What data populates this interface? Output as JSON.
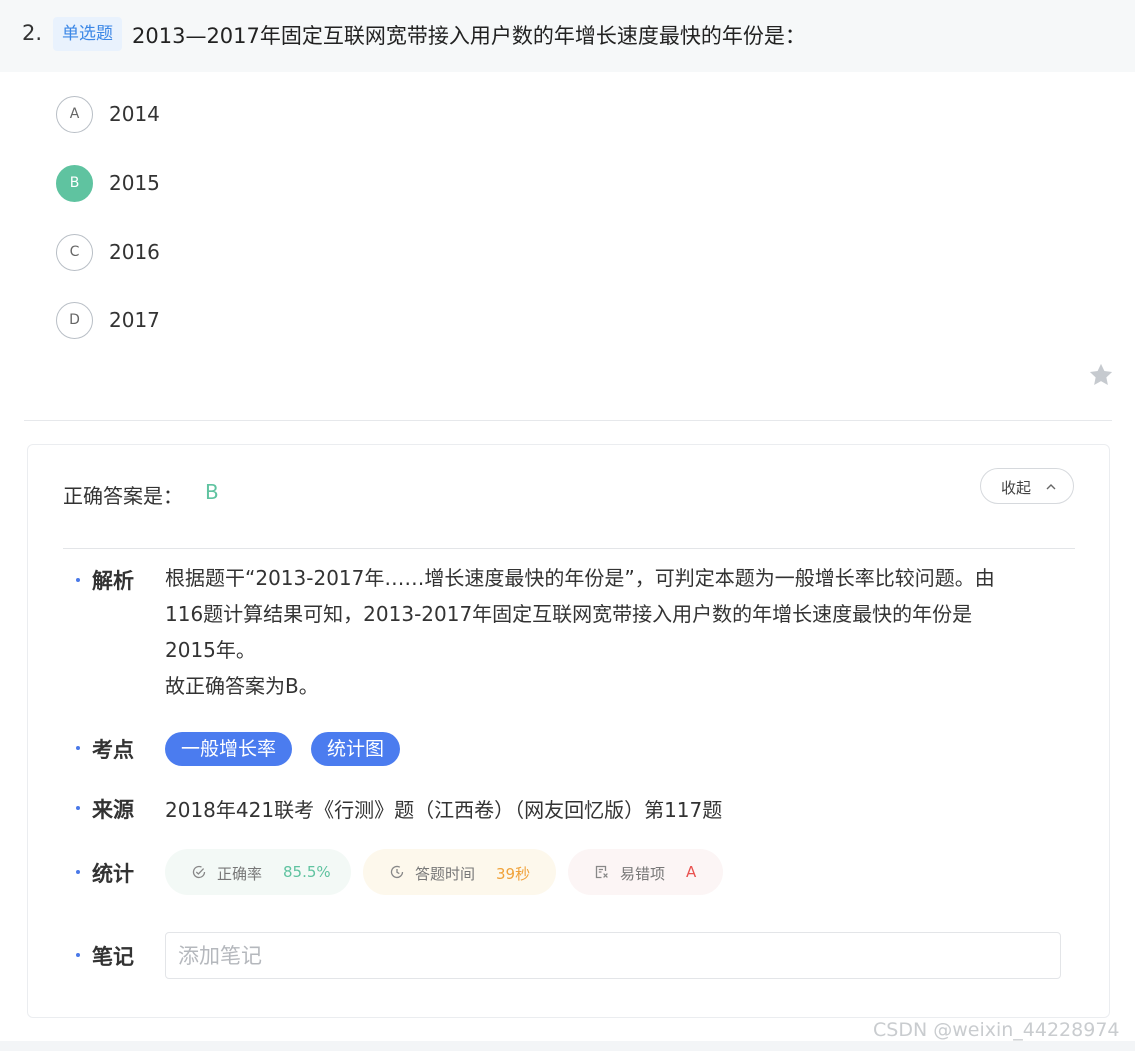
{
  "question": {
    "number": "2.",
    "type_badge": "单选题",
    "title": "2013—2017年固定互联网宽带接入用户数的年增长速度最快的年份是："
  },
  "options": [
    {
      "letter": "A",
      "text": "2014",
      "selected": false
    },
    {
      "letter": "B",
      "text": "2015",
      "selected": true
    },
    {
      "letter": "C",
      "text": "2016",
      "selected": false
    },
    {
      "letter": "D",
      "text": "2017",
      "selected": false
    }
  ],
  "favorite_icon": "star-icon",
  "answer_panel": {
    "answer_label": "正确答案是：",
    "answer_value": "B",
    "collapse_label": "收起",
    "collapse_icon": "chevron-up-icon",
    "analysis": {
      "label": "解析",
      "lines": [
        "根据题干“2013-2017年……增长速度最快的年份是”，可判定本题为一般增长率比较问题。由",
        "116题计算结果可知，2013-2017年固定互联网宽带接入用户数的年增长速度最快的年份是",
        "2015年。",
        "故正确答案为B。"
      ]
    },
    "topics": {
      "label": "考点",
      "tags": [
        "一般增长率",
        "统计图"
      ]
    },
    "source": {
      "label": "来源",
      "text": "2018年421联考《行测》题（江西卷）（网友回忆版）第117题"
    },
    "stats": {
      "label": "统计",
      "accuracy": {
        "label": "正确率",
        "value": "85.5%",
        "color": "#5fc3a0",
        "icon": "check-circle-icon"
      },
      "time": {
        "label": "答题时间",
        "value": "39秒",
        "color": "#f0a23a",
        "icon": "clock-icon"
      },
      "error": {
        "label": "易错项",
        "value": "A",
        "color": "#e9514f",
        "icon": "error-doc-icon"
      }
    },
    "notes": {
      "label": "笔记",
      "placeholder": "添加笔记",
      "value": ""
    }
  },
  "watermark": "CSDN @weixin_44228974",
  "colors": {
    "accent_blue": "#4b7cef",
    "selected_green": "#5fc3a0",
    "badge_blue": "#3b87e6"
  }
}
